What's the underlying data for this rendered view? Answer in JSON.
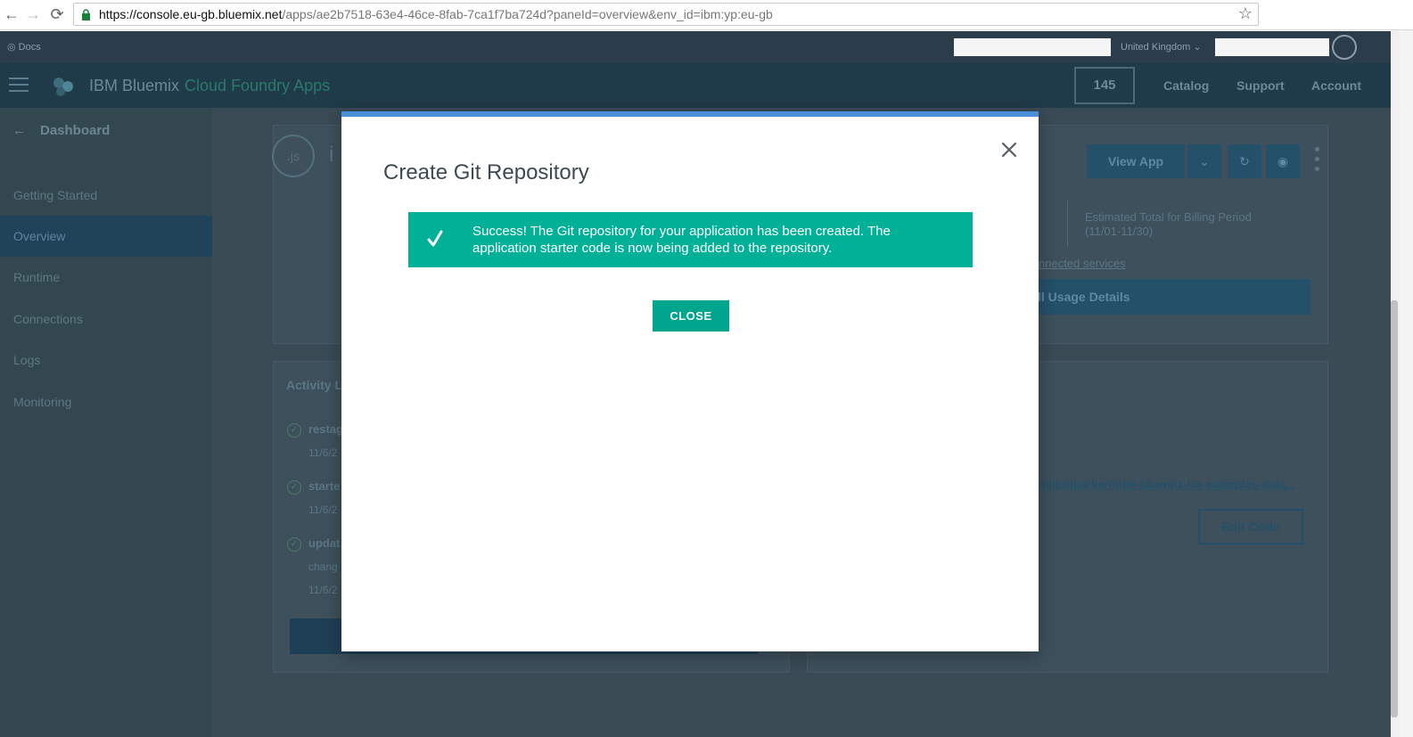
{
  "browser": {
    "url_host": "https://console.eu-gb.bluemix.net",
    "url_rest": "/apps/ae2b7518-63e4-46ce-8fab-7ca1f7ba724d?paneId=overview&env_id=ibm:yp:eu-gb",
    "back_icon": "←",
    "forward_icon": "→",
    "reload_icon": "⟳",
    "star_icon": "☆"
  },
  "topstrip": {
    "docs": "Docs",
    "region": "United Kingdom"
  },
  "appbar": {
    "brand": "IBM Bluemix",
    "section": "Cloud Foundry Apps",
    "count": "145",
    "nav": [
      "Catalog",
      "Support",
      "Account"
    ]
  },
  "sidebar": {
    "back_label": "Dashboard",
    "items": [
      "Getting Started",
      "Overview",
      "Runtime",
      "Connections",
      "Logs",
      "Monitoring"
    ],
    "active_index": 1
  },
  "main": {
    "app_badge": ".js",
    "app_name_partial": "i",
    "view_app": "View App",
    "billing_label": "Estimated Total for Billing Period",
    "billing_range": "(11/01-11/30)",
    "connected_services": "nnected services",
    "usage_details": "ll Usage Details",
    "activity_title": "Activity L",
    "activity": [
      {
        "action": "restag",
        "date": "11/6/2"
      },
      {
        "action": "starte",
        "date": "11/6/2"
      },
      {
        "action": "updat",
        "sub": "chang",
        "date": "11/6/2"
      }
    ],
    "repo_link": "miltonbarker/intel-bluemix-iot-examples-data...",
    "edit_code": "Edit Code"
  },
  "modal": {
    "title": "Create Git Repository",
    "success_message": "Success! The Git repository for your application has been created. The application starter code is now being added to the repository.",
    "close_label": "CLOSE"
  },
  "colors": {
    "success": "#00b097",
    "modal_accent": "#4a90d9",
    "close_button": "#00a58e"
  }
}
